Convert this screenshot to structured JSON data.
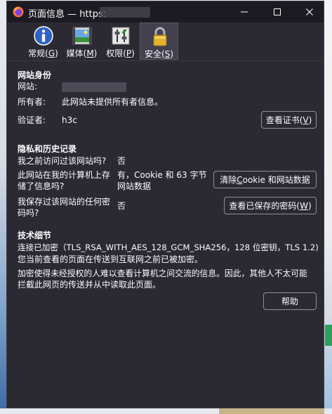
{
  "window": {
    "title": "页面信息 — https:"
  },
  "tabs": [
    {
      "label_prefix": "常规(",
      "accesskey": "G",
      "label_suffix": ")",
      "icon": "info-icon"
    },
    {
      "label_prefix": "媒体(",
      "accesskey": "M",
      "label_suffix": ")",
      "icon": "media-icon"
    },
    {
      "label_prefix": "权限(",
      "accesskey": "P",
      "label_suffix": ")",
      "icon": "permissions-icon"
    },
    {
      "label_prefix": "安全(",
      "accesskey": "S",
      "label_suffix": ")",
      "icon": "lock-icon",
      "selected": true
    }
  ],
  "identity": {
    "heading": "网站身份",
    "website_label": "网站:",
    "owner_label": "所有者:",
    "owner_value": "此网站未提供所有者信息。",
    "verifier_label": "验证者:",
    "verifier_value": "h3c",
    "view_cert_prefix": "查看证书(",
    "view_cert_key": "V",
    "view_cert_suffix": ")"
  },
  "privacy": {
    "heading": "隐私和历史记录",
    "visited_q": "我之前访问过该网站吗?",
    "visited_a": "否",
    "stored_q_line1": "此网站在我的计算机上存",
    "stored_q_line2": "储了信息吗?",
    "stored_a_line1": "有，Cookie 和 63 字节",
    "stored_a_line2": "网站数据",
    "clear_prefix": "清除 ",
    "clear_key": "C",
    "clear_suffix": "ookie 和网站数据",
    "password_q_line1": "我保存过该网站的任何密",
    "password_q_line2": "码吗?",
    "password_a": "否",
    "view_pw_prefix": "查看已保存的密码(",
    "view_pw_key": "W",
    "view_pw_suffix": ")"
  },
  "technical": {
    "heading": "技术细节",
    "line1": "连接已加密（TLS_RSA_WITH_AES_128_GCM_SHA256，128 位密钥，TLS 1.2)",
    "line2": "您当前查看的页面在传送到互联网之前已被加密。",
    "line3": "加密使得未经授权的人难以查看计算机之间交流的信息。因此，其他人不太可能",
    "line4": "拦截此网页的传送并从中读取此页面。"
  },
  "help_button": "帮助",
  "colors": {
    "dialog_bg": "#2b2a33",
    "titlebar_bg": "#1c1b22",
    "selected_tab_bg": "#42414d",
    "text": "#fbfbfe",
    "button_border": "#8f8f9d"
  }
}
